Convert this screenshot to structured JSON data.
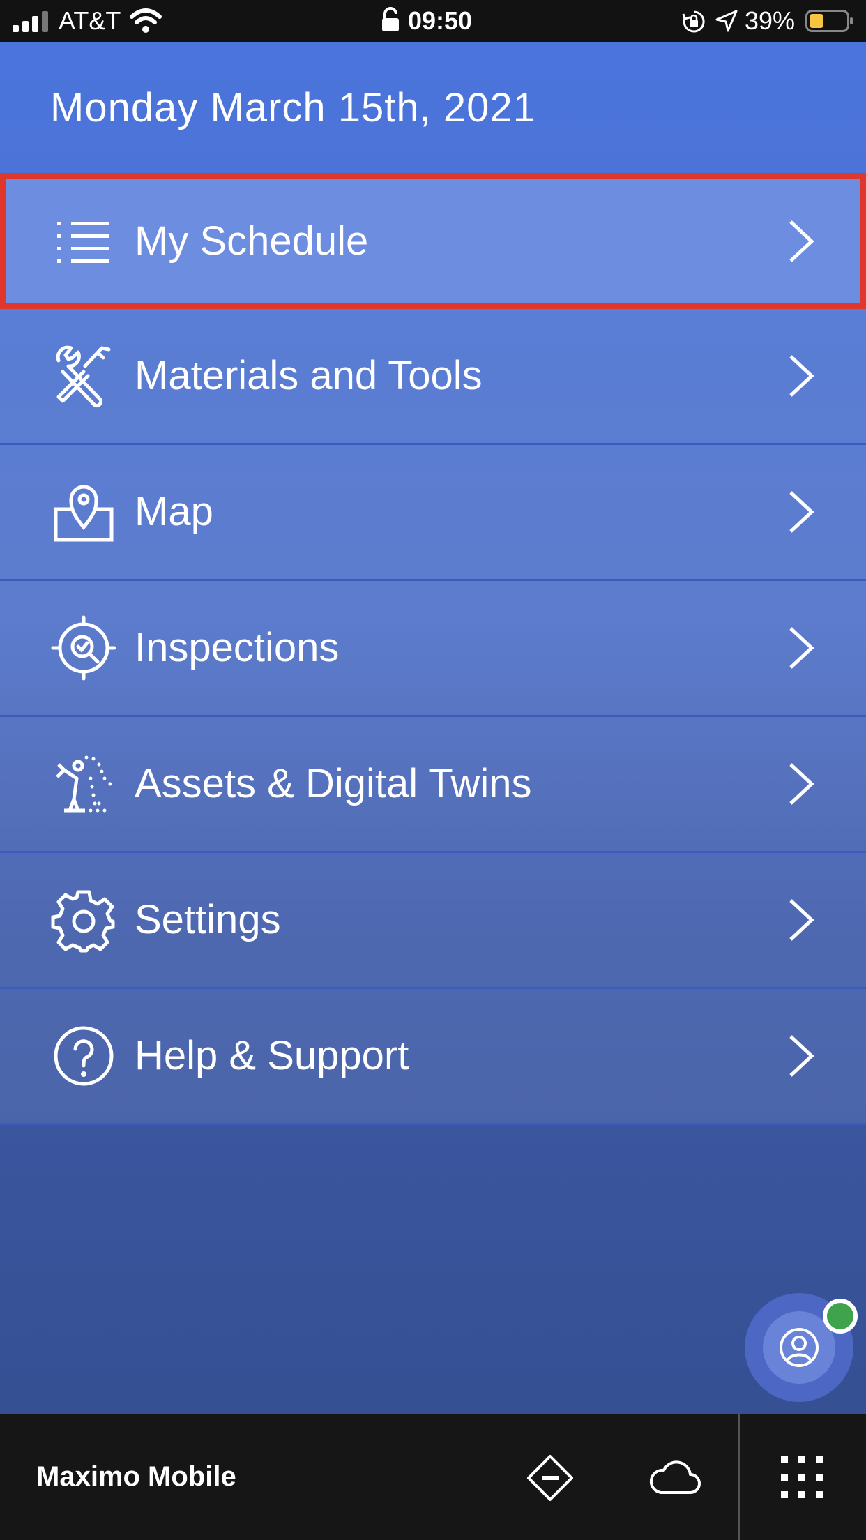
{
  "status_bar": {
    "carrier": "AT&T",
    "time": "09:50",
    "battery_percent": "39%"
  },
  "header": {
    "date": "Monday March 15th, 2021"
  },
  "menu": {
    "items": [
      {
        "label": "My Schedule",
        "icon": "list-icon",
        "selected": true
      },
      {
        "label": "Materials and Tools",
        "icon": "tools-icon",
        "selected": false
      },
      {
        "label": "Map",
        "icon": "map-pin-icon",
        "selected": false
      },
      {
        "label": "Inspections",
        "icon": "inspection-target-icon",
        "selected": false
      },
      {
        "label": "Assets & Digital Twins",
        "icon": "robot-arm-icon",
        "selected": false
      },
      {
        "label": "Settings",
        "icon": "gear-icon",
        "selected": false
      },
      {
        "label": "Help & Support",
        "icon": "help-icon",
        "selected": false
      }
    ]
  },
  "bottom_bar": {
    "app_name": "Maximo Mobile"
  },
  "colors": {
    "highlight": "#e0372c",
    "online": "#3fa34d",
    "header_blue": "#4a75de"
  }
}
